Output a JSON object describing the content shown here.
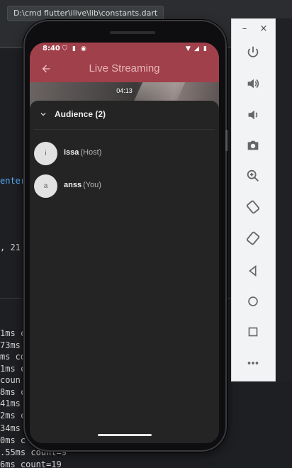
{
  "ide": {
    "tooltip_path": "D:\\cmd flutter\\ilive\\lib\\constants.dart",
    "code_fragment_center": "enter",
    "code_fragment_number": ", 21",
    "console_lines": [
      "1ms c",
      "73ms",
      "ms co",
      "1ms c",
      " coun",
      "8ms c",
      "41ms",
      "2ms c",
      "34ms",
      "0ms c",
      ".55ms count=9",
      "6ms count=19"
    ]
  },
  "status_bar": {
    "time": "8:40"
  },
  "app_bar": {
    "back_icon": "arrow-left-icon",
    "title": "Live Streaming"
  },
  "video": {
    "timer": "04:13"
  },
  "audience_sheet": {
    "title": "Audience (2)",
    "members": [
      {
        "initial": "i",
        "name": "issa",
        "role": "(Host)"
      },
      {
        "initial": "a",
        "name": "anss",
        "role": "(You)"
      }
    ]
  },
  "emulator": {
    "minimize_label": "–",
    "close_label": "×",
    "buttons": [
      "power-icon",
      "volume-up-icon",
      "volume-down-icon",
      "camera-icon",
      "zoom-icon",
      "rotate-left-icon",
      "rotate-right-icon",
      "back-triangle-icon",
      "home-circle-icon",
      "overview-square-icon",
      "more-icon"
    ]
  },
  "colors": {
    "app_bar": "#a0404a",
    "sheet_bg": "#242424",
    "ide_bg": "#1e1f22"
  }
}
